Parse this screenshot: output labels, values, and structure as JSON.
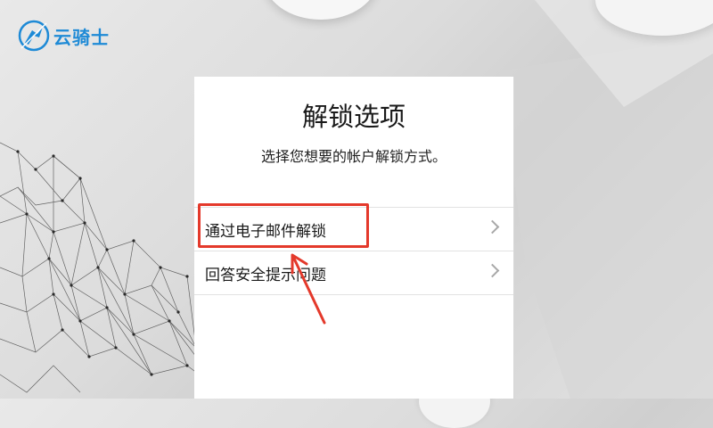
{
  "logo": {
    "text": "云骑士",
    "icon": "knight-icon"
  },
  "screen": {
    "title": "解锁选项",
    "subtitle": "选择您想要的帐户解锁方式。",
    "options": [
      {
        "label": "通过电子邮件解锁",
        "icon": "chevron-right-icon",
        "highlighted": true
      },
      {
        "label": "回答安全提示问题",
        "icon": "chevron-right-icon",
        "highlighted": false
      }
    ]
  },
  "colors": {
    "logo": "#1e8ad6",
    "highlight": "#e4392b"
  }
}
